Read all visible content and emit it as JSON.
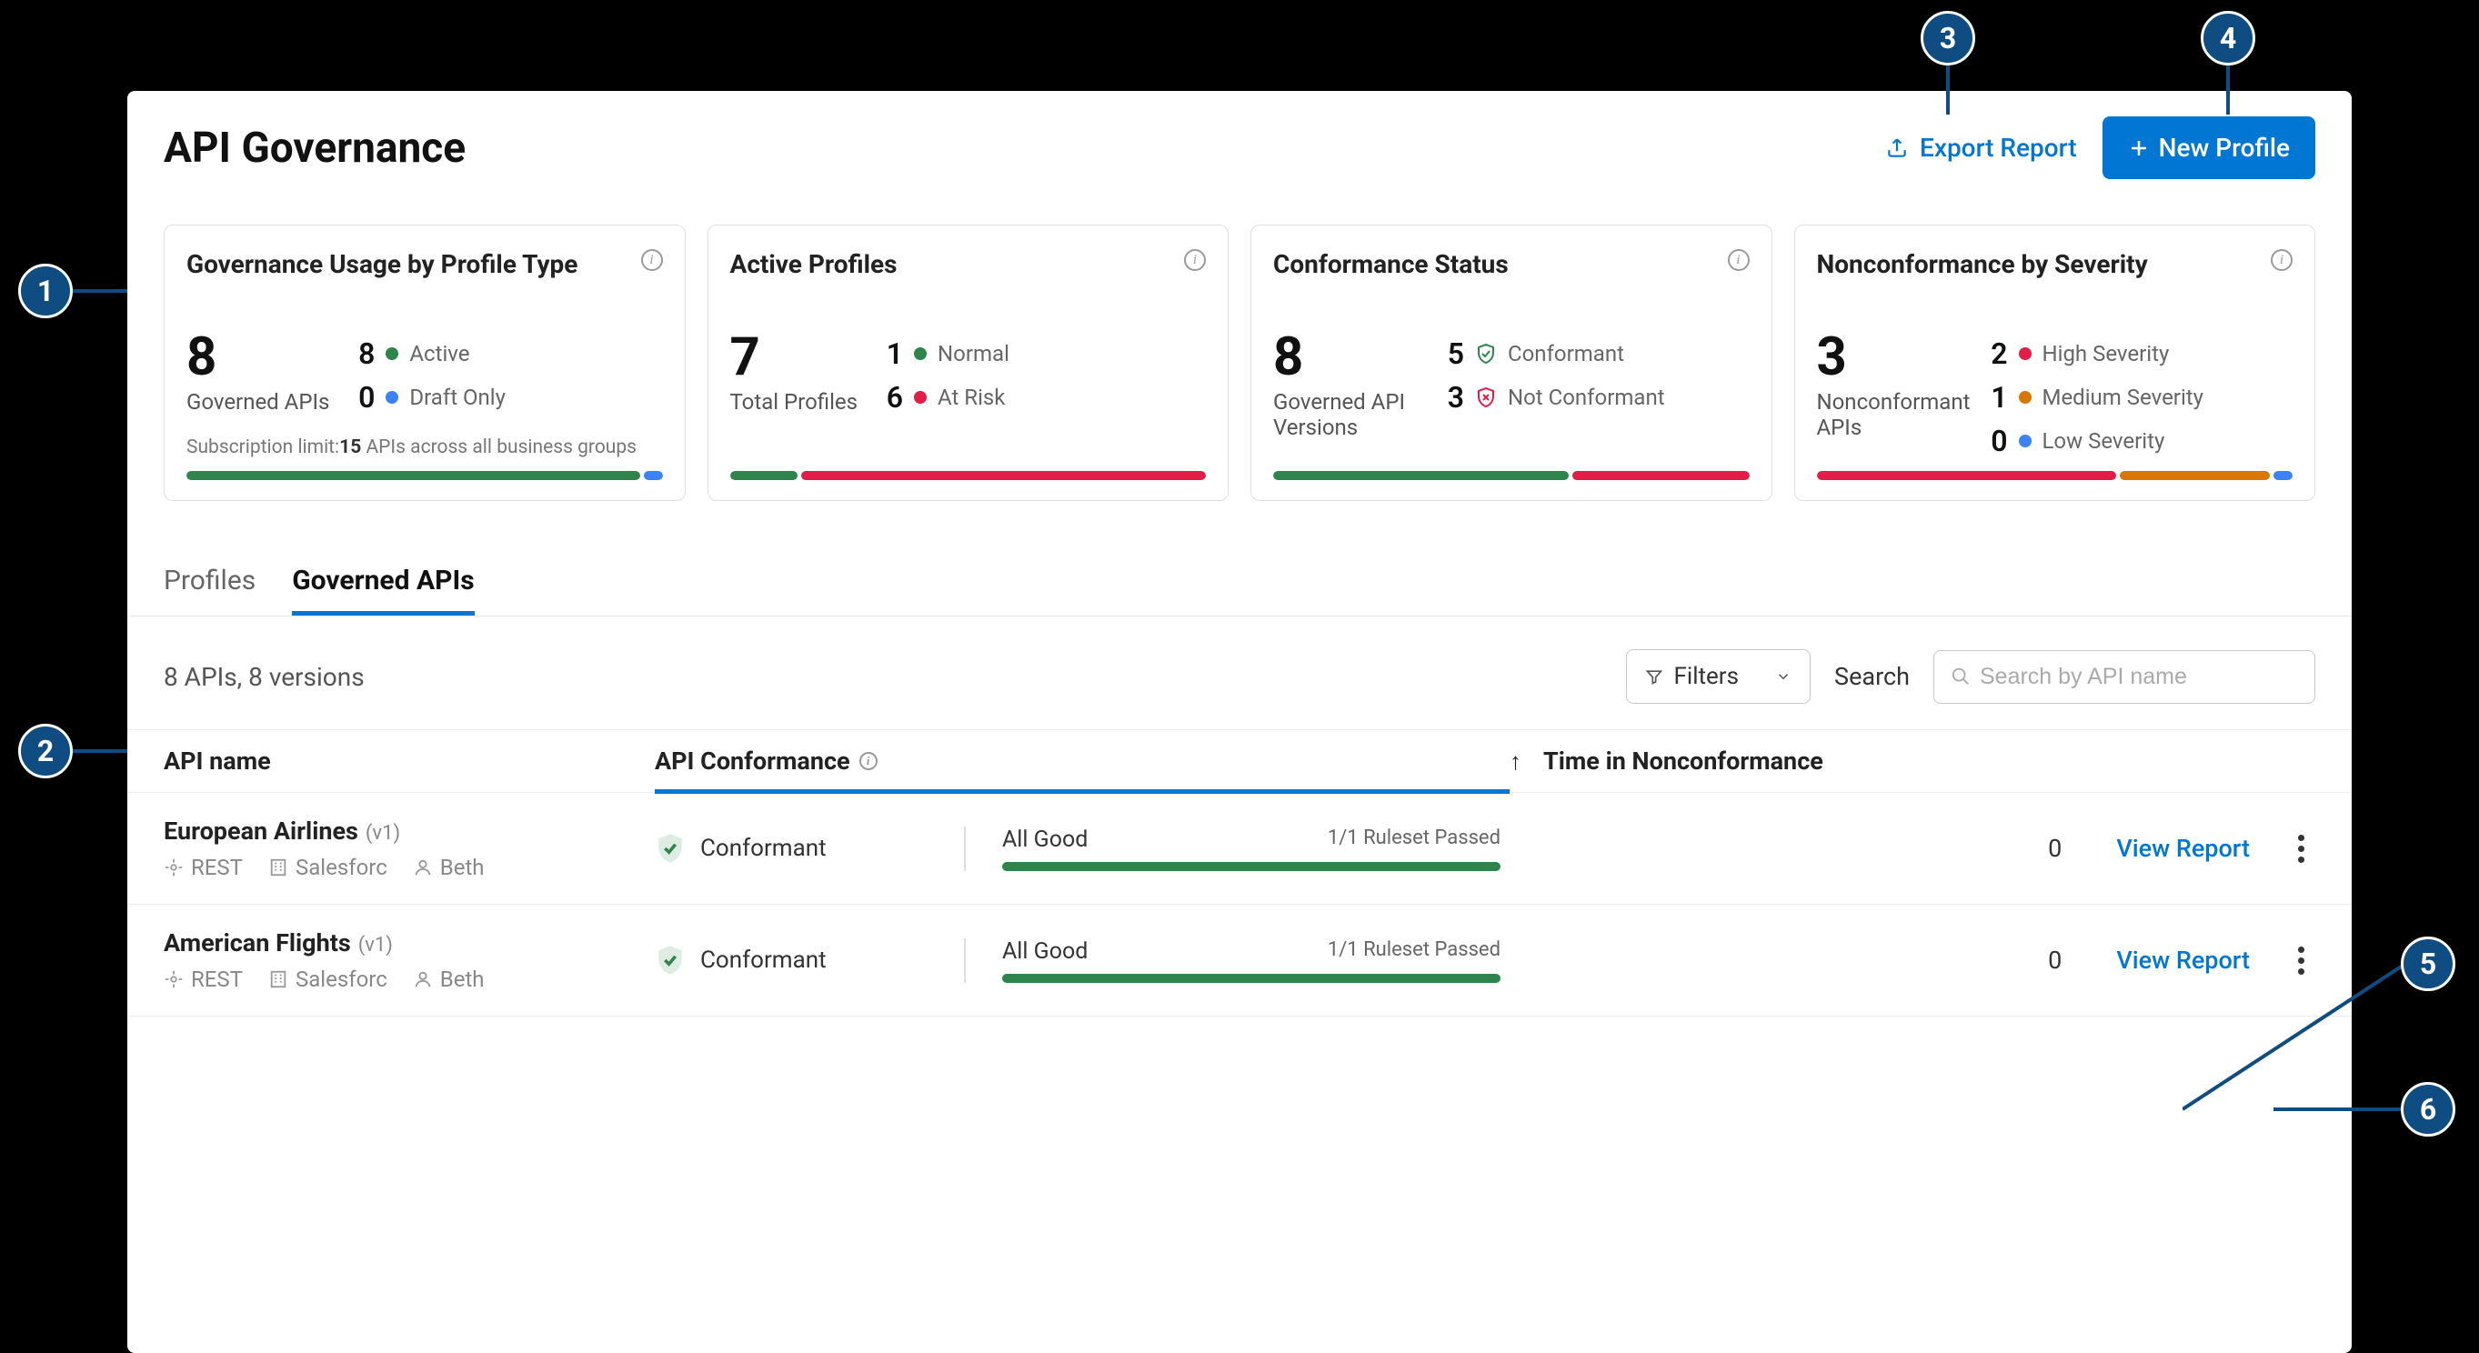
{
  "header": {
    "title": "API Governance",
    "export_label": "Export Report",
    "new_profile_label": "New Profile"
  },
  "cards": {
    "usage": {
      "title": "Governance Usage by Profile Type",
      "big_number": "8",
      "big_label": "Governed APIs",
      "items": [
        {
          "num": "8",
          "color": "green",
          "label": "Active"
        },
        {
          "num": "0",
          "color": "blue",
          "label": "Draft Only"
        }
      ],
      "subnote_prefix": "Subscription limit:",
      "subnote_bold": "15",
      "subnote_suffix": " APIs across all business groups"
    },
    "profiles": {
      "title": "Active Profiles",
      "big_number": "7",
      "big_label": "Total Profiles",
      "items": [
        {
          "num": "1",
          "color": "green",
          "label": "Normal"
        },
        {
          "num": "6",
          "color": "red",
          "label": "At Risk"
        }
      ]
    },
    "conformance": {
      "title": "Conformance Status",
      "big_number": "8",
      "big_label": "Governed API Versions",
      "items": [
        {
          "num": "5",
          "icon": "shield-green",
          "label": "Conformant"
        },
        {
          "num": "3",
          "icon": "shield-red",
          "label": "Not Conformant"
        }
      ]
    },
    "severity": {
      "title": "Nonconformance by Severity",
      "big_number": "3",
      "big_label": "Nonconformant APIs",
      "items": [
        {
          "num": "2",
          "color": "red",
          "label": "High Severity"
        },
        {
          "num": "1",
          "color": "amber",
          "label": "Medium Severity"
        },
        {
          "num": "0",
          "color": "blue",
          "label": "Low Severity"
        }
      ]
    }
  },
  "tabs": {
    "profiles": "Profiles",
    "governed": "Governed APIs"
  },
  "toolbar": {
    "summary": "8 APIs, 8 versions",
    "filters_label": "Filters",
    "search_label": "Search",
    "search_placeholder": "Search by API name"
  },
  "columns": {
    "name": "API name",
    "conf": "API Conformance",
    "time": "Time in Nonconformance"
  },
  "rows": [
    {
      "name": "European Airlines",
      "ver": "(v1)",
      "meta": {
        "type": "REST",
        "org": "Salesforc",
        "user": "Beth"
      },
      "conf": "Conformant",
      "ruleset_status": "All Good",
      "ruleset_detail": "1/1 Ruleset Passed",
      "time": "0",
      "view": "View Report"
    },
    {
      "name": "American Flights",
      "ver": "(v1)",
      "meta": {
        "type": "REST",
        "org": "Salesforc",
        "user": "Beth"
      },
      "conf": "Conformant",
      "ruleset_status": "All Good",
      "ruleset_detail": "1/1 Ruleset Passed",
      "time": "0",
      "view": "View Report"
    }
  ],
  "callouts": [
    "1",
    "2",
    "3",
    "4",
    "5",
    "6"
  ],
  "chart_data": [
    {
      "type": "bar",
      "title": "Governance Usage by Profile Type",
      "categories": [
        "Active",
        "Draft Only"
      ],
      "values": [
        8,
        0
      ],
      "total_label": "Governed APIs",
      "total": 8,
      "subscription_limit": 15
    },
    {
      "type": "bar",
      "title": "Active Profiles",
      "categories": [
        "Normal",
        "At Risk"
      ],
      "values": [
        1,
        6
      ],
      "total_label": "Total Profiles",
      "total": 7
    },
    {
      "type": "bar",
      "title": "Conformance Status",
      "categories": [
        "Conformant",
        "Not Conformant"
      ],
      "values": [
        5,
        3
      ],
      "total_label": "Governed API Versions",
      "total": 8
    },
    {
      "type": "bar",
      "title": "Nonconformance by Severity",
      "categories": [
        "High Severity",
        "Medium Severity",
        "Low Severity"
      ],
      "values": [
        2,
        1,
        0
      ],
      "total_label": "Nonconformant APIs",
      "total": 3
    }
  ],
  "colors": {
    "primary": "#0176d3",
    "green": "#2e844a",
    "red": "#e11d48",
    "amber": "#d97706",
    "blue": "#3b82f6",
    "callout": "#0f4c81"
  }
}
